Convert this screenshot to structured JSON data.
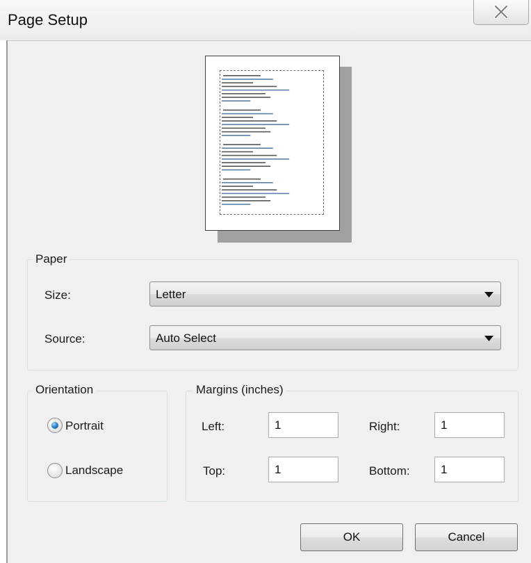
{
  "window": {
    "title": "Page Setup",
    "close_icon": "close-icon"
  },
  "paper": {
    "group_title": "Paper",
    "size_label": "Size:",
    "size_value": "Letter",
    "source_label": "Source:",
    "source_value": "Auto Select"
  },
  "orientation": {
    "group_title": "Orientation",
    "portrait_label": "Portrait",
    "landscape_label": "Landscape",
    "selected": "Portrait"
  },
  "margins": {
    "group_title": "Margins (inches)",
    "left_label": "Left:",
    "left_value": "1",
    "right_label": "Right:",
    "right_value": "1",
    "top_label": "Top:",
    "top_value": "1",
    "bottom_label": "Bottom:",
    "bottom_value": "1"
  },
  "buttons": {
    "ok": "OK",
    "cancel": "Cancel"
  },
  "colors": {
    "radio_selected": "#2f86cc",
    "dialog_background": "#f0f0f0",
    "group_border": "#d5dfe5"
  }
}
